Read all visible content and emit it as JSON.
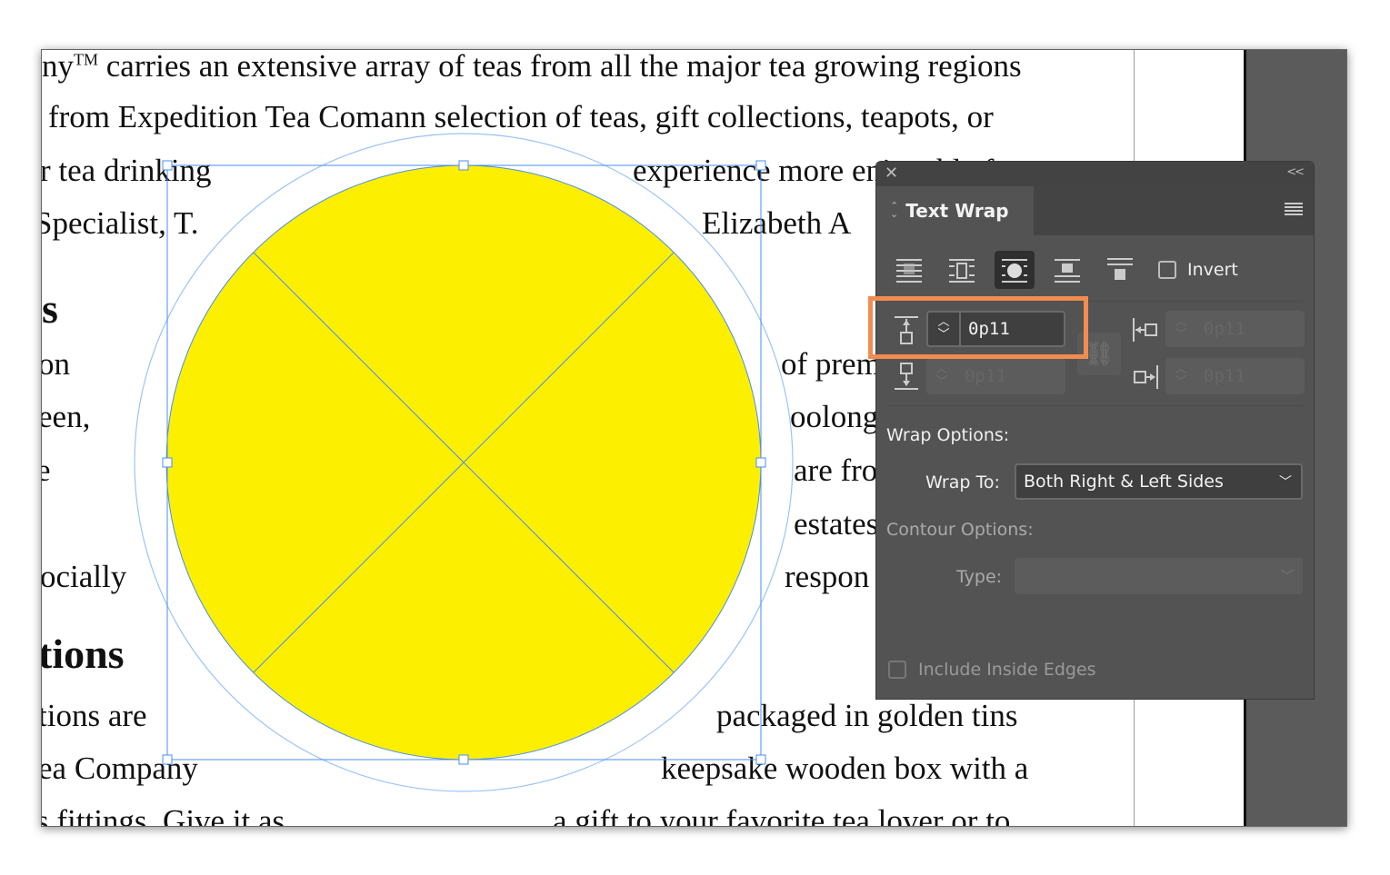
{
  "document": {
    "left_lines": [
      {
        "text": "ny",
        "sup": "TM",
        "rest": " carries an extensive array of teas from all the major tea growing regions"
      },
      {
        "text": "from Expedition Tea Comann selection of teas, gift collections, teapots, or"
      },
      {
        "text": "r tea drinking"
      },
      {
        "text": "Specialist, T."
      },
      {
        "text": "s",
        "bold": true
      },
      {
        "text": "on"
      },
      {
        "text": "een,"
      },
      {
        "text": "e"
      },
      {
        "text": "ocially"
      },
      {
        "text": "tions",
        "bold": true
      },
      {
        "text": "tions are"
      },
      {
        "text": "ea Company"
      },
      {
        "text": "s fittings. Give it as"
      }
    ],
    "right_lines": [
      "experience more enjoyable f",
      "Elizabeth A",
      "of prem",
      "oolong",
      "are fro",
      "estates",
      "respon",
      "packaged in golden tins",
      "keepsake wooden box with a",
      "a gift to your favorite tea lover or to"
    ]
  },
  "colors": {
    "shape_fill": "#fcef00",
    "selection": "#4a8ef0",
    "highlight": "#f28c50",
    "panel_bg": "#535353"
  },
  "panel": {
    "title": "Text Wrap",
    "close_icon": "close-icon",
    "collapse_label": "<<",
    "wrap_modes": [
      "no-text-wrap",
      "wrap-around-bounding-box",
      "wrap-around-object-shape",
      "jump-object",
      "jump-to-next-column"
    ],
    "selected_mode": "wrap-around-object-shape",
    "invert_label": "Invert",
    "invert_checked": false,
    "offsets": {
      "top": "0p11",
      "bottom": "0p11",
      "left": "0p11",
      "right": "0p11"
    },
    "wrap_options_label": "Wrap Options:",
    "wrap_to_label": "Wrap To:",
    "wrap_to_value": "Both Right & Left Sides",
    "contour_options_label": "Contour Options:",
    "type_label": "Type:",
    "type_value": "",
    "include_inside_edges_label": "Include Inside Edges",
    "include_inside_edges_checked": false
  }
}
